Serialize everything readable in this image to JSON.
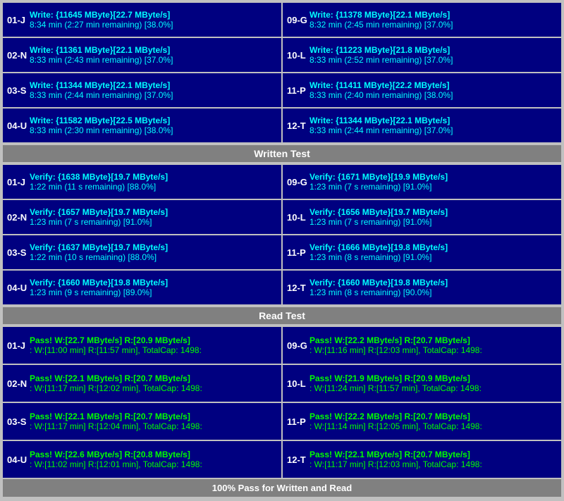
{
  "writeSection": {
    "rows": [
      {
        "left": {
          "id": "01-J",
          "line1": "Write: {11645 MByte}[22.7 MByte/s]",
          "line2": "8:34 min (2:27 min remaining)  [38.0%]"
        },
        "right": {
          "id": "09-G",
          "line1": "Write: {11378 MByte}[22.1 MByte/s]",
          "line2": "8:32 min (2:45 min remaining)  [37.0%]"
        }
      },
      {
        "left": {
          "id": "02-N",
          "line1": "Write: {11361 MByte}[22.1 MByte/s]",
          "line2": "8:33 min (2:43 min remaining)  [37.0%]"
        },
        "right": {
          "id": "10-L",
          "line1": "Write: {11223 MByte}[21.8 MByte/s]",
          "line2": "8:33 min (2:52 min remaining)  [37.0%]"
        }
      },
      {
        "left": {
          "id": "03-S",
          "line1": "Write: {11344 MByte}[22.1 MByte/s]",
          "line2": "8:33 min (2:44 min remaining)  [37.0%]"
        },
        "right": {
          "id": "11-P",
          "line1": "Write: {11411 MByte}[22.2 MByte/s]",
          "line2": "8:33 min (2:40 min remaining)  [38.0%]"
        }
      },
      {
        "left": {
          "id": "04-U",
          "line1": "Write: {11582 MByte}[22.5 MByte/s]",
          "line2": "8:33 min (2:30 min remaining)  [38.0%]"
        },
        "right": {
          "id": "12-T",
          "line1": "Write: {11344 MByte}[22.1 MByte/s]",
          "line2": "8:33 min (2:44 min remaining)  [37.0%]"
        }
      }
    ],
    "header": "Written Test"
  },
  "verifySection": {
    "rows": [
      {
        "left": {
          "id": "01-J",
          "line1": "Verify: {1638 MByte}[19.7 MByte/s]",
          "line2": "1:22 min (11 s remaining)   [88.0%]"
        },
        "right": {
          "id": "09-G",
          "line1": "Verify: {1671 MByte}[19.9 MByte/s]",
          "line2": "1:23 min (7 s remaining)   [91.0%]"
        }
      },
      {
        "left": {
          "id": "02-N",
          "line1": "Verify: {1657 MByte}[19.7 MByte/s]",
          "line2": "1:23 min (7 s remaining)   [91.0%]"
        },
        "right": {
          "id": "10-L",
          "line1": "Verify: {1656 MByte}[19.7 MByte/s]",
          "line2": "1:23 min (7 s remaining)   [91.0%]"
        }
      },
      {
        "left": {
          "id": "03-S",
          "line1": "Verify: {1637 MByte}[19.7 MByte/s]",
          "line2": "1:22 min (10 s remaining)   [88.0%]"
        },
        "right": {
          "id": "11-P",
          "line1": "Verify: {1666 MByte}[19.8 MByte/s]",
          "line2": "1:23 min (8 s remaining)   [91.0%]"
        }
      },
      {
        "left": {
          "id": "04-U",
          "line1": "Verify: {1660 MByte}[19.8 MByte/s]",
          "line2": "1:23 min (9 s remaining)   [89.0%]"
        },
        "right": {
          "id": "12-T",
          "line1": "Verify: {1660 MByte}[19.8 MByte/s]",
          "line2": "1:23 min (8 s remaining)   [90.0%]"
        }
      }
    ],
    "header": "Read Test"
  },
  "passSection": {
    "rows": [
      {
        "left": {
          "id": "01-J",
          "line1": "Pass! W:[22.7 MByte/s] R:[20.9 MByte/s]",
          "line2": ": W:[11:00 min] R:[11:57 min], TotalCap: 1498:"
        },
        "right": {
          "id": "09-G",
          "line1": "Pass! W:[22.2 MByte/s] R:[20.7 MByte/s]",
          "line2": ": W:[11:16 min] R:[12:03 min], TotalCap: 1498:"
        }
      },
      {
        "left": {
          "id": "02-N",
          "line1": "Pass! W:[22.1 MByte/s] R:[20.7 MByte/s]",
          "line2": ": W:[11:17 min] R:[12:02 min], TotalCap: 1498:"
        },
        "right": {
          "id": "10-L",
          "line1": "Pass! W:[21.9 MByte/s] R:[20.9 MByte/s]",
          "line2": ": W:[11:24 min] R:[11:57 min], TotalCap: 1498:"
        }
      },
      {
        "left": {
          "id": "03-S",
          "line1": "Pass! W:[22.1 MByte/s] R:[20.7 MByte/s]",
          "line2": ": W:[11:17 min] R:[12:04 min], TotalCap: 1498:"
        },
        "right": {
          "id": "11-P",
          "line1": "Pass! W:[22.2 MByte/s] R:[20.7 MByte/s]",
          "line2": ": W:[11:14 min] R:[12:05 min], TotalCap: 1498:"
        }
      },
      {
        "left": {
          "id": "04-U",
          "line1": "Pass! W:[22.6 MByte/s] R:[20.8 MByte/s]",
          "line2": ": W:[11:02 min] R:[12:01 min], TotalCap: 1498:"
        },
        "right": {
          "id": "12-T",
          "line1": "Pass! W:[22.1 MByte/s] R:[20.7 MByte/s]",
          "line2": ": W:[11:17 min] R:[12:03 min], TotalCap: 1498:"
        }
      }
    ]
  },
  "footer": "100% Pass for Written and Read"
}
